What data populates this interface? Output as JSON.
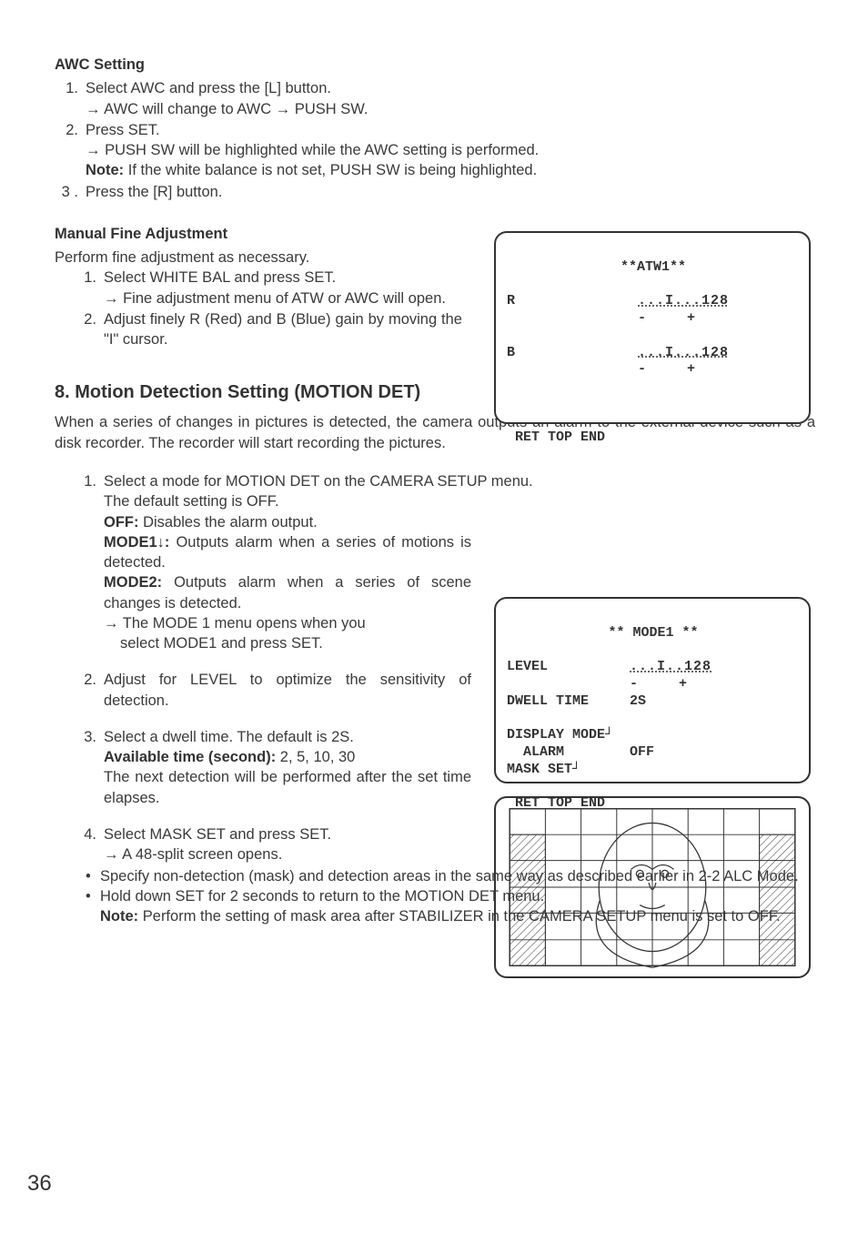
{
  "awc": {
    "heading": "AWC Setting",
    "step1": {
      "num": "1.",
      "text": "Select AWC and press the [L] button.",
      "sub1": "→ AWC will change to AWC → PUSH SW."
    },
    "step2": {
      "num": "2.",
      "text": "Press SET.",
      "sub1": "→ PUSH SW will be highlighted while the AWC setting is performed.",
      "note_label": "Note:",
      "note_text": " If the white balance is not set, PUSH SW is being highlighted."
    },
    "step3": {
      "num": "3 .",
      "text": "Press the [R] button."
    }
  },
  "manual": {
    "heading": "Manual Fine Adjustment",
    "intro": "Perform fine adjustment as necessary.",
    "step1": {
      "num": "1.",
      "text": "Select WHITE BAL and press SET.",
      "sub1": "→ Fine adjustment menu of ATW or AWC will open."
    },
    "step2": {
      "num": "2.",
      "text": "Adjust finely R (Red) and B (Blue) gain by moving the \"I\" cursor."
    }
  },
  "panel_atw": {
    "title": "**ATW1**",
    "r_label": "R",
    "r_val": "...I...128",
    "r_scale": "-     +",
    "b_label": "B",
    "b_val": "...I...128",
    "b_scale": "-     +",
    "footer": " RET TOP END"
  },
  "section8": {
    "heading": "8. Motion Detection Setting (MOTION DET)",
    "intro": "When a series of changes in pictures is detected, the camera outputs an alarm to the external device such as a disk recorder. The recorder will start recording the pictures.",
    "step1": {
      "num": "1.",
      "text": "Select a mode for MOTION DET on the CAMERA SETUP menu.",
      "line2": "The default setting is OFF.",
      "off_label": "OFF:",
      "off_text": " Disables the alarm output.",
      "mode1_label": "MODE1↓:",
      "mode1_text": " Outputs alarm when a series of motions is detected.",
      "mode2_label": "MODE2:",
      "mode2_text": " Outputs alarm when a series of scene changes is detected.",
      "sub1_a": "→ The MODE 1 menu opens when you",
      "sub1_b": "select MODE1 and press SET."
    },
    "step2": {
      "num": "2.",
      "text": "Adjust for LEVEL to optimize the sensitivity of detection."
    },
    "step3": {
      "num": "3.",
      "text": "Select a dwell time. The default is 2S.",
      "avail_label": "Available time (second):",
      "avail_text": " 2, 5, 10, 30",
      "line3": "The next detection will be performed after the set time elapses."
    },
    "step4": {
      "num": "4.",
      "text": "Select MASK SET and press SET.",
      "sub1": "→ A 48-split screen opens."
    },
    "bullet1": "Specify non-detection (mask) and detection areas in the same way as described earlier in 2-2 ALC Mode.",
    "bullet2": "Hold down SET for 2 seconds to return to the MOTION DET menu.",
    "note_label": "Note:",
    "note_text": " Perform the setting of mask area after STABILIZER in the CAMERA SETUP menu is set to OFF."
  },
  "panel_mode1": {
    "title": "** MODE1 **",
    "level_label": "LEVEL",
    "level_val": "...I..128",
    "level_scale": "-     +",
    "dwell_label": "DWELL TIME",
    "dwell_val": "2S",
    "disp_label": "DISPLAY MODE┘",
    "alarm_label": "  ALARM",
    "alarm_val": "OFF",
    "mask_label": "MASK SET┘",
    "footer": " RET TOP END"
  },
  "chart_data": {
    "type": "table",
    "note": "This page contains two camera OSD menu diagrams and one 8x6 mask-set grid illustration. No quantitative chart data.",
    "osd_atw1": {
      "R": 128,
      "B": 128
    },
    "osd_mode1": {
      "LEVEL": 128,
      "DWELL_TIME_S": 2,
      "ALARM": "OFF"
    },
    "mask_grid": {
      "cols": 8,
      "rows": 6
    }
  },
  "page_number": "36"
}
